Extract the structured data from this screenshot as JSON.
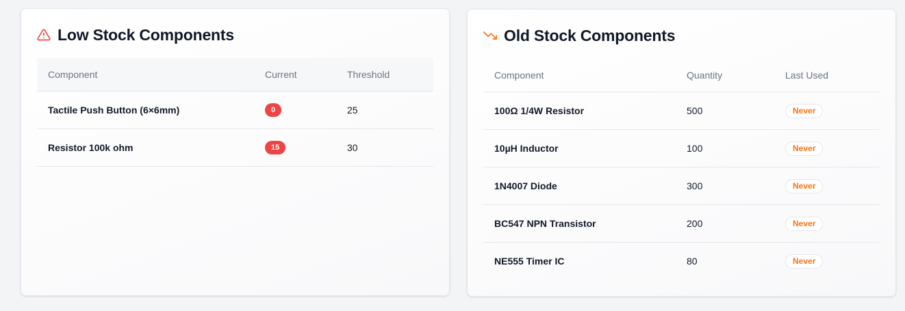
{
  "low_stock": {
    "title": "Low Stock Components",
    "icon": "warning-triangle-icon",
    "icon_color": "#ef4444",
    "columns": [
      "Component",
      "Current",
      "Threshold"
    ],
    "rows": [
      {
        "component": "Tactile Push Button (6×6mm)",
        "current": "0",
        "threshold": "25"
      },
      {
        "component": "Resistor 100k ohm",
        "current": "15",
        "threshold": "30"
      }
    ]
  },
  "old_stock": {
    "title": "Old Stock Components",
    "icon": "trending-down-icon",
    "icon_color": "#f97316",
    "columns": [
      "Component",
      "Quantity",
      "Last Used"
    ],
    "rows": [
      {
        "component": "100Ω 1/4W Resistor",
        "quantity": "500",
        "last_used": "Never"
      },
      {
        "component": "10µH Inductor",
        "quantity": "100",
        "last_used": "Never"
      },
      {
        "component": "1N4007 Diode",
        "quantity": "300",
        "last_used": "Never"
      },
      {
        "component": "BC547 NPN Transistor",
        "quantity": "200",
        "last_used": "Never"
      },
      {
        "component": "NE555 Timer IC",
        "quantity": "80",
        "last_used": "Never"
      }
    ]
  }
}
